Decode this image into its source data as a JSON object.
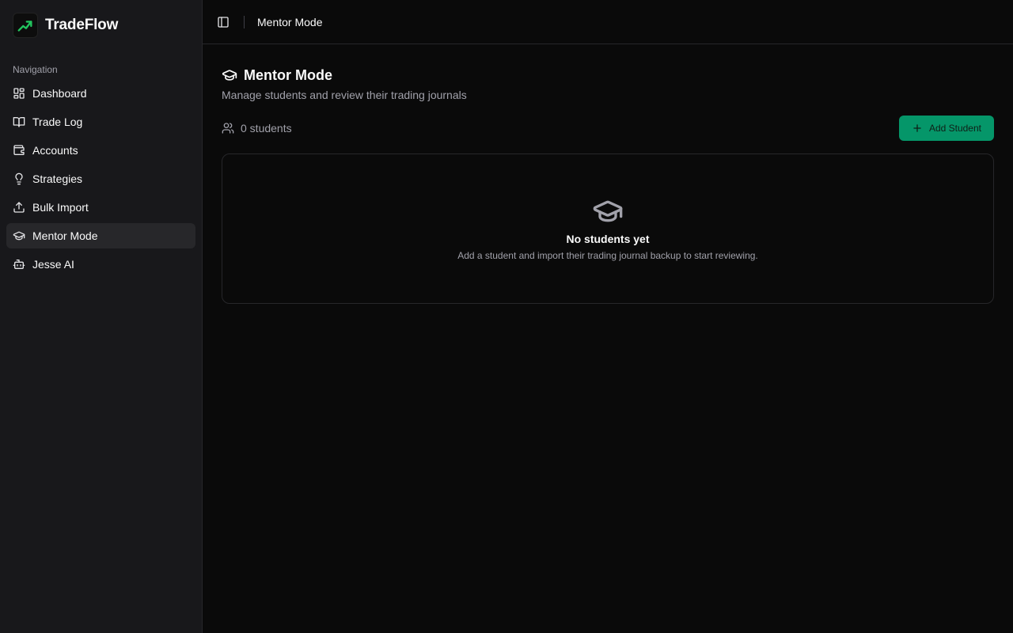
{
  "brand": {
    "name": "TradeFlow",
    "logo_icon": "trending-up-icon",
    "accent": "#22c55e"
  },
  "sidebar": {
    "heading": "Navigation",
    "items": [
      {
        "label": "Dashboard",
        "icon": "dashboard-grid-icon",
        "active": false
      },
      {
        "label": "Trade Log",
        "icon": "book-open-icon",
        "active": false
      },
      {
        "label": "Accounts",
        "icon": "wallet-icon",
        "active": false
      },
      {
        "label": "Strategies",
        "icon": "lightbulb-icon",
        "active": false
      },
      {
        "label": "Bulk Import",
        "icon": "upload-icon",
        "active": false
      },
      {
        "label": "Mentor Mode",
        "icon": "graduation-cap-icon",
        "active": true
      },
      {
        "label": "Jesse AI",
        "icon": "bot-icon",
        "active": false
      }
    ]
  },
  "topbar": {
    "breadcrumb": "Mentor Mode",
    "toggle_icon": "sidebar-toggle-icon"
  },
  "page": {
    "title": "Mentor Mode",
    "subtitle": "Manage students and review their trading journals",
    "student_count": "0 students",
    "add_button": "Add Student",
    "add_button_color": "#059669"
  },
  "empty_state": {
    "title": "No students yet",
    "description": "Add a student and import their trading journal backup to start reviewing."
  }
}
